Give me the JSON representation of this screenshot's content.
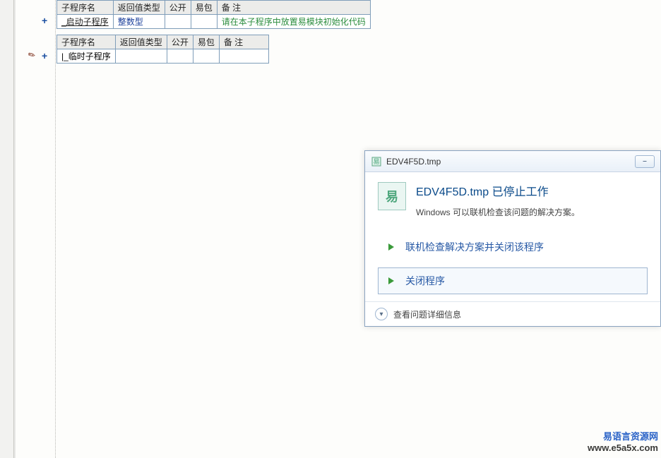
{
  "table_headers": {
    "name": "子程序名",
    "ret_type": "返回值类型",
    "public": "公开",
    "ypackage": "易包",
    "remark": "备 注"
  },
  "tables": [
    {
      "row": {
        "name": "_启动子程序",
        "ret_type": "整数型",
        "public": "",
        "ypackage": "",
        "remark": "请在本子程序中放置易模块初始化代码"
      }
    },
    {
      "row": {
        "name": "|_临时子程序",
        "ret_type": "",
        "public": "",
        "ypackage": "",
        "remark": ""
      }
    }
  ],
  "gutter": {
    "plus": "+"
  },
  "dialog": {
    "titlebar": "EDV4F5D.tmp",
    "heading": "EDV4F5D.tmp 已停止工作",
    "subtext": "Windows 可以联机检查该问题的解决方案。",
    "options": [
      "联机检查解决方案并关闭该程序",
      "关闭程序"
    ],
    "details": "查看问题详细信息",
    "app_icon_glyph": "易",
    "minimize_glyph": "⎯"
  },
  "watermark": {
    "line1": "易语言资源网",
    "line2": "www.e5a5x.com"
  }
}
